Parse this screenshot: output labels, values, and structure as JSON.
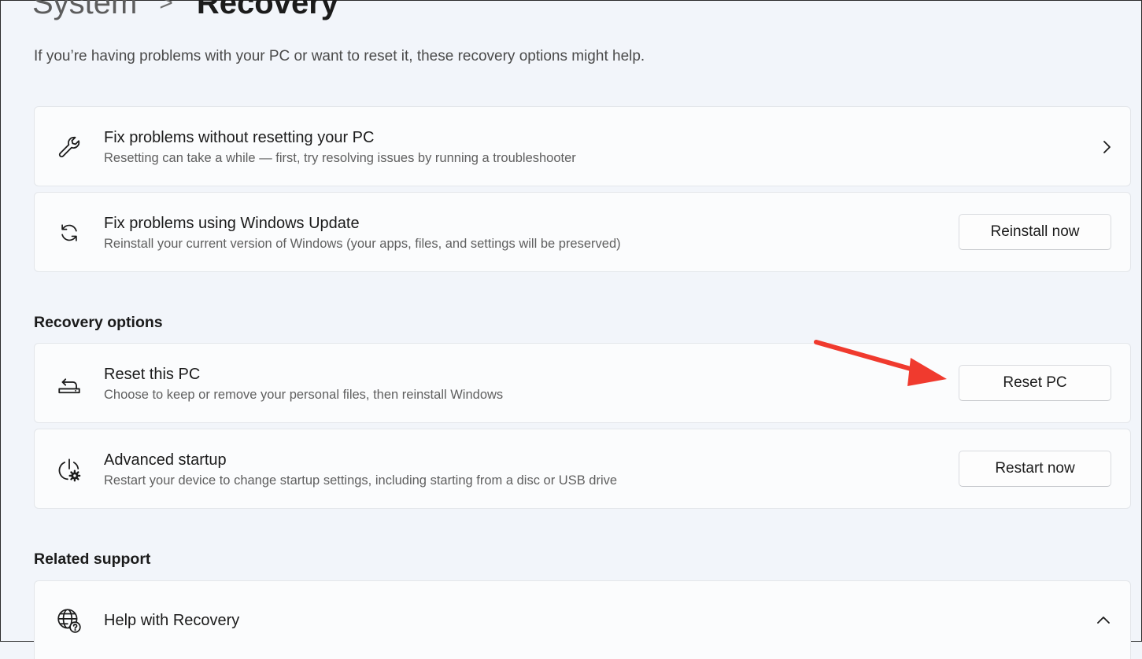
{
  "breadcrumb": {
    "parent": "System",
    "separator": ">",
    "current": "Recovery"
  },
  "intro": "If you’re having problems with your PC or want to reset it, these recovery options might help.",
  "cards_top": [
    {
      "title": "Fix problems without resetting your PC",
      "subtitle": "Resetting can take a while — first, try resolving issues by running a troubleshooter",
      "icon": "wrench-icon",
      "action": "chevron-right-icon"
    },
    {
      "title": "Fix problems using Windows Update",
      "subtitle": "Reinstall your current version of Windows (your apps, files, and settings will be preserved)",
      "icon": "refresh-icon",
      "button_label": "Reinstall now"
    }
  ],
  "recovery_options": {
    "heading": "Recovery options",
    "items": [
      {
        "title": "Reset this PC",
        "subtitle": "Choose to keep or remove your personal files, then reinstall Windows",
        "icon": "reset-pc-icon",
        "button_label": "Reset PC"
      },
      {
        "title": "Advanced startup",
        "subtitle": "Restart your device to change startup settings, including starting from a disc or USB drive",
        "icon": "advanced-startup-icon",
        "button_label": "Restart now"
      }
    ]
  },
  "related_support": {
    "heading": "Related support",
    "items": [
      {
        "title": "Help with Recovery",
        "icon": "globe-help-icon",
        "action": "chevron-up-icon"
      }
    ]
  },
  "annotation": {
    "arrow_color": "#f03a2e"
  }
}
